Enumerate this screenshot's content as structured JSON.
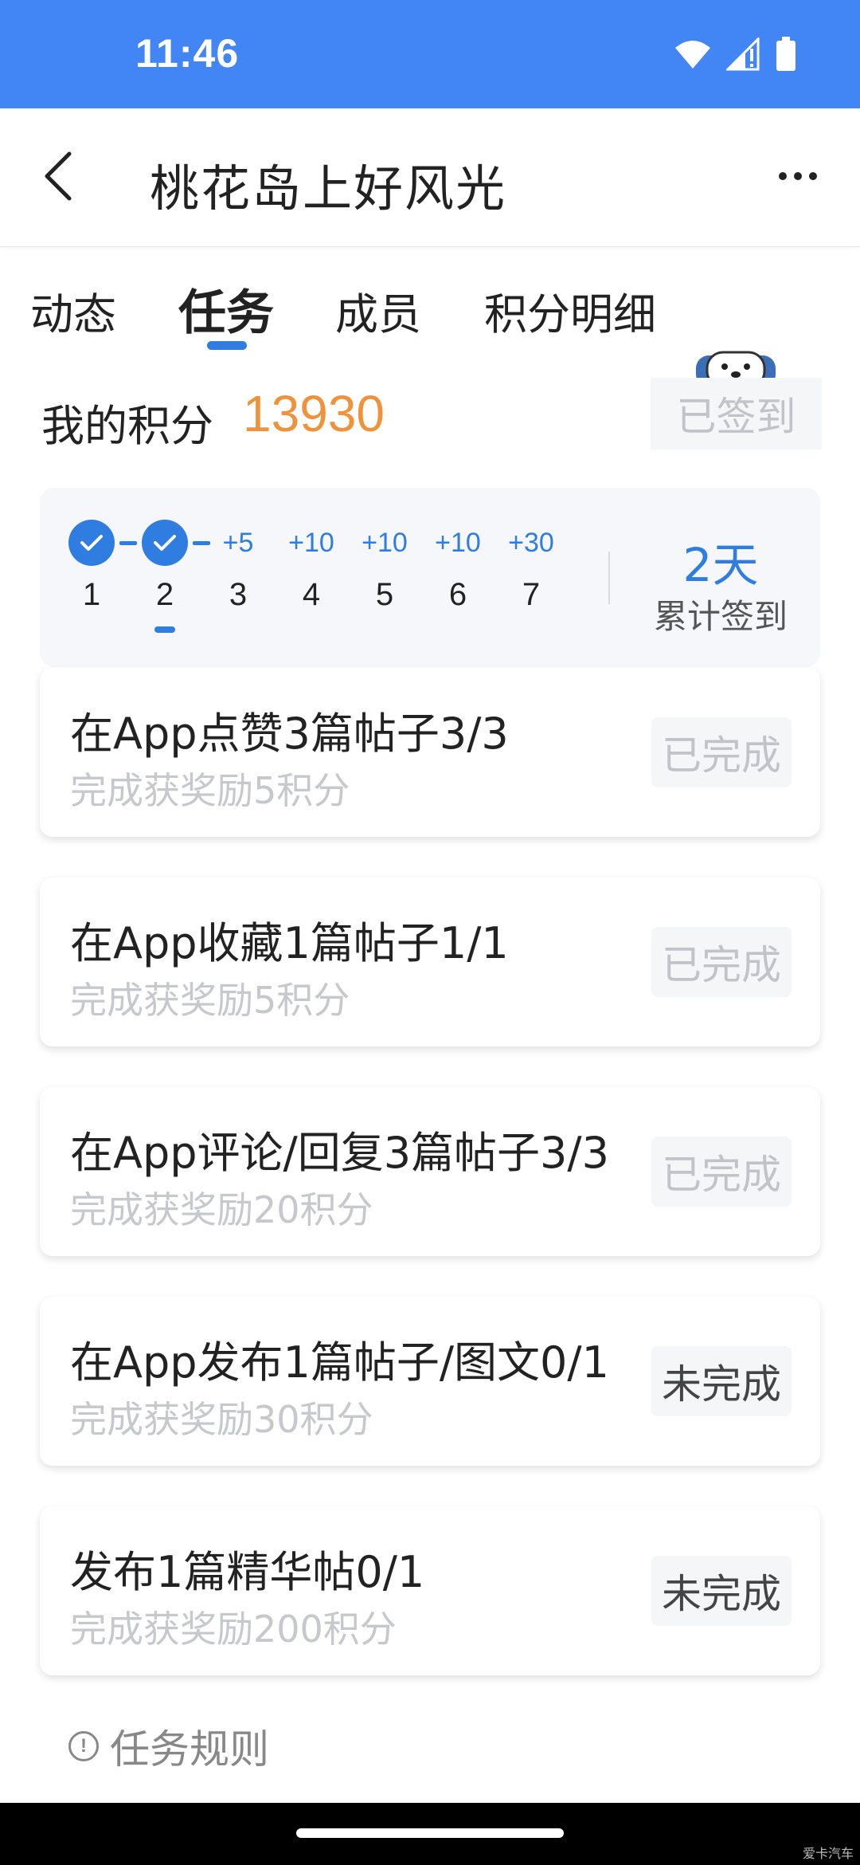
{
  "status_bar": {
    "time": "11:46"
  },
  "nav": {
    "title": "桃花岛上好风光"
  },
  "tabs": [
    {
      "label": "动态"
    },
    {
      "label": "任务"
    },
    {
      "label": "成员"
    },
    {
      "label": "积分明细"
    }
  ],
  "points": {
    "label": "我的积分",
    "value": "13930",
    "signin_label": "已签到"
  },
  "calendar": {
    "days": [
      {
        "num": "1",
        "bonus": "",
        "checked": true
      },
      {
        "num": "2",
        "bonus": "",
        "checked": true
      },
      {
        "num": "3",
        "bonus": "+5",
        "checked": false
      },
      {
        "num": "4",
        "bonus": "+10",
        "checked": false
      },
      {
        "num": "5",
        "bonus": "+10",
        "checked": false
      },
      {
        "num": "6",
        "bonus": "+10",
        "checked": false
      },
      {
        "num": "7",
        "bonus": "+30",
        "checked": false
      }
    ],
    "total_days": "2天",
    "total_label": "累计签到"
  },
  "tasks": [
    {
      "title": "在App点赞3篇帖子3/3",
      "reward": "完成获奖励5积分",
      "status": "已完成"
    },
    {
      "title": "在App收藏1篇帖子1/1",
      "reward": "完成获奖励5积分",
      "status": "已完成"
    },
    {
      "title": "在App评论/回复3篇帖子3/3",
      "reward": "完成获奖励20积分",
      "status": "已完成"
    },
    {
      "title": "在App发布1篇帖子/图文0/1",
      "reward": "完成获奖励30积分",
      "status": "未完成"
    },
    {
      "title": "发布1篇精华帖0/1",
      "reward": "完成获奖励200积分",
      "status": "未完成"
    }
  ],
  "rules": {
    "label": "任务规则"
  },
  "footer": {
    "watermark": "爱卡汽车"
  },
  "colors": {
    "accent": "#2f7de1",
    "status_bar": "#4285f4",
    "points": "#f0923a"
  }
}
